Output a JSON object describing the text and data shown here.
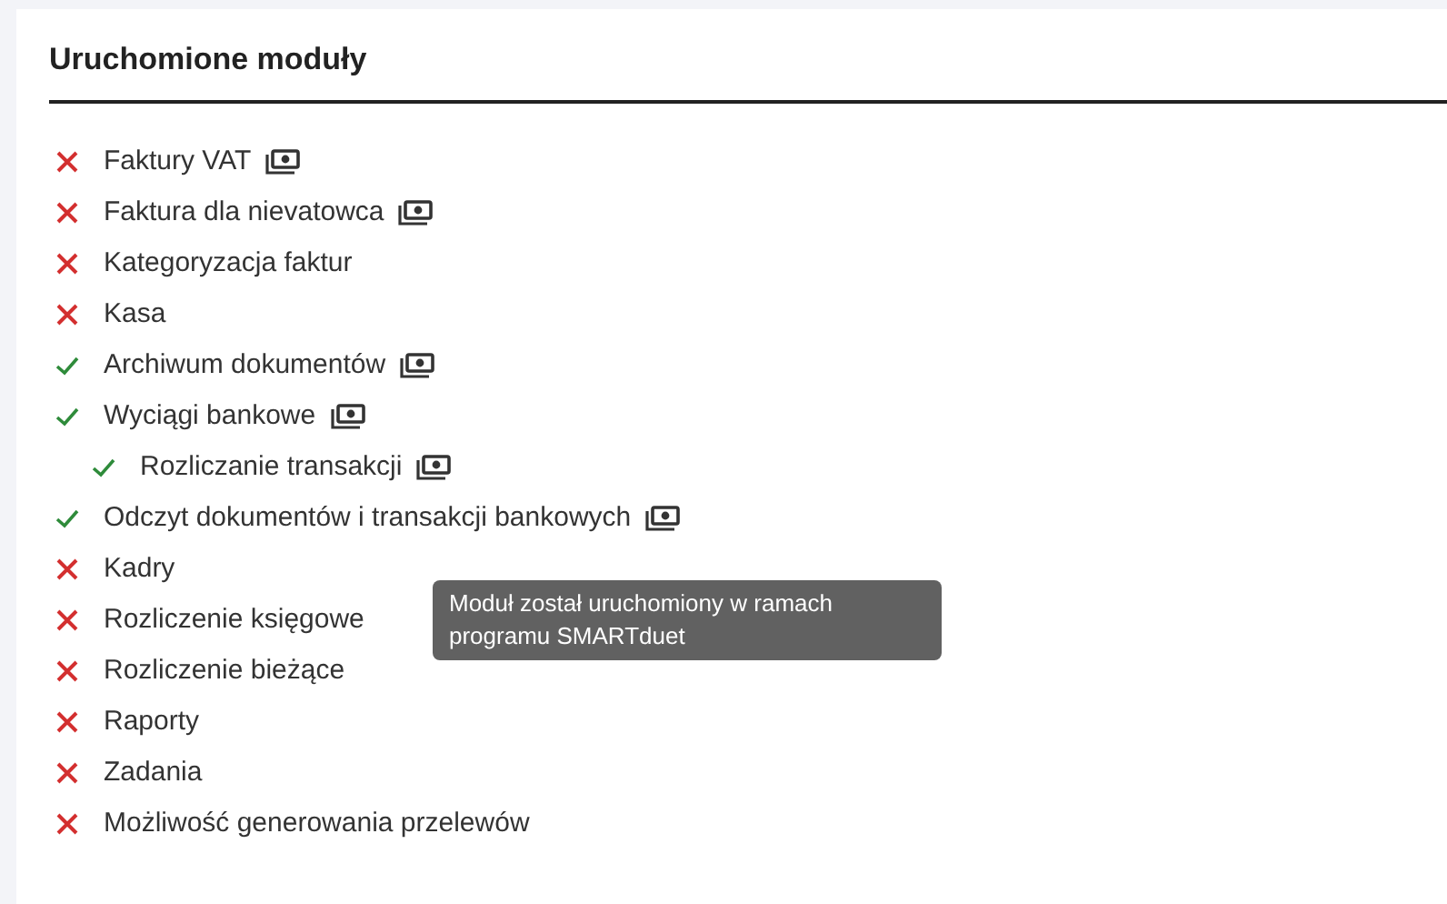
{
  "title": "Uruchomione moduły",
  "modules": [
    {
      "label": "Faktury VAT",
      "enabled": false,
      "program_badge": true
    },
    {
      "label": "Faktura dla nievatowca",
      "enabled": false,
      "program_badge": true
    },
    {
      "label": "Kategoryzacja faktur",
      "enabled": false,
      "program_badge": false
    },
    {
      "label": "Kasa",
      "enabled": false,
      "program_badge": false
    },
    {
      "label": "Archiwum dokumentów",
      "enabled": true,
      "program_badge": true
    },
    {
      "label": "Wyciągi bankowe",
      "enabled": true,
      "program_badge": true,
      "children": [
        {
          "label": "Rozliczanie transakcji",
          "enabled": true,
          "program_badge": true
        }
      ]
    },
    {
      "label": "Odczyt dokumentów i transakcji bankowych",
      "enabled": true,
      "program_badge": true
    },
    {
      "label": "Kadry",
      "enabled": false,
      "program_badge": false
    },
    {
      "label": "Rozliczenie księgowe",
      "enabled": false,
      "program_badge": false
    },
    {
      "label": "Rozliczenie bieżące",
      "enabled": false,
      "program_badge": false
    },
    {
      "label": "Raporty",
      "enabled": false,
      "program_badge": false
    },
    {
      "label": "Zadania",
      "enabled": false,
      "program_badge": false
    },
    {
      "label": "Możliwość generowania przelewów",
      "enabled": false,
      "program_badge": false
    }
  ],
  "tooltip": "Moduł został uruchomiony w ramach programu SMARTduet"
}
